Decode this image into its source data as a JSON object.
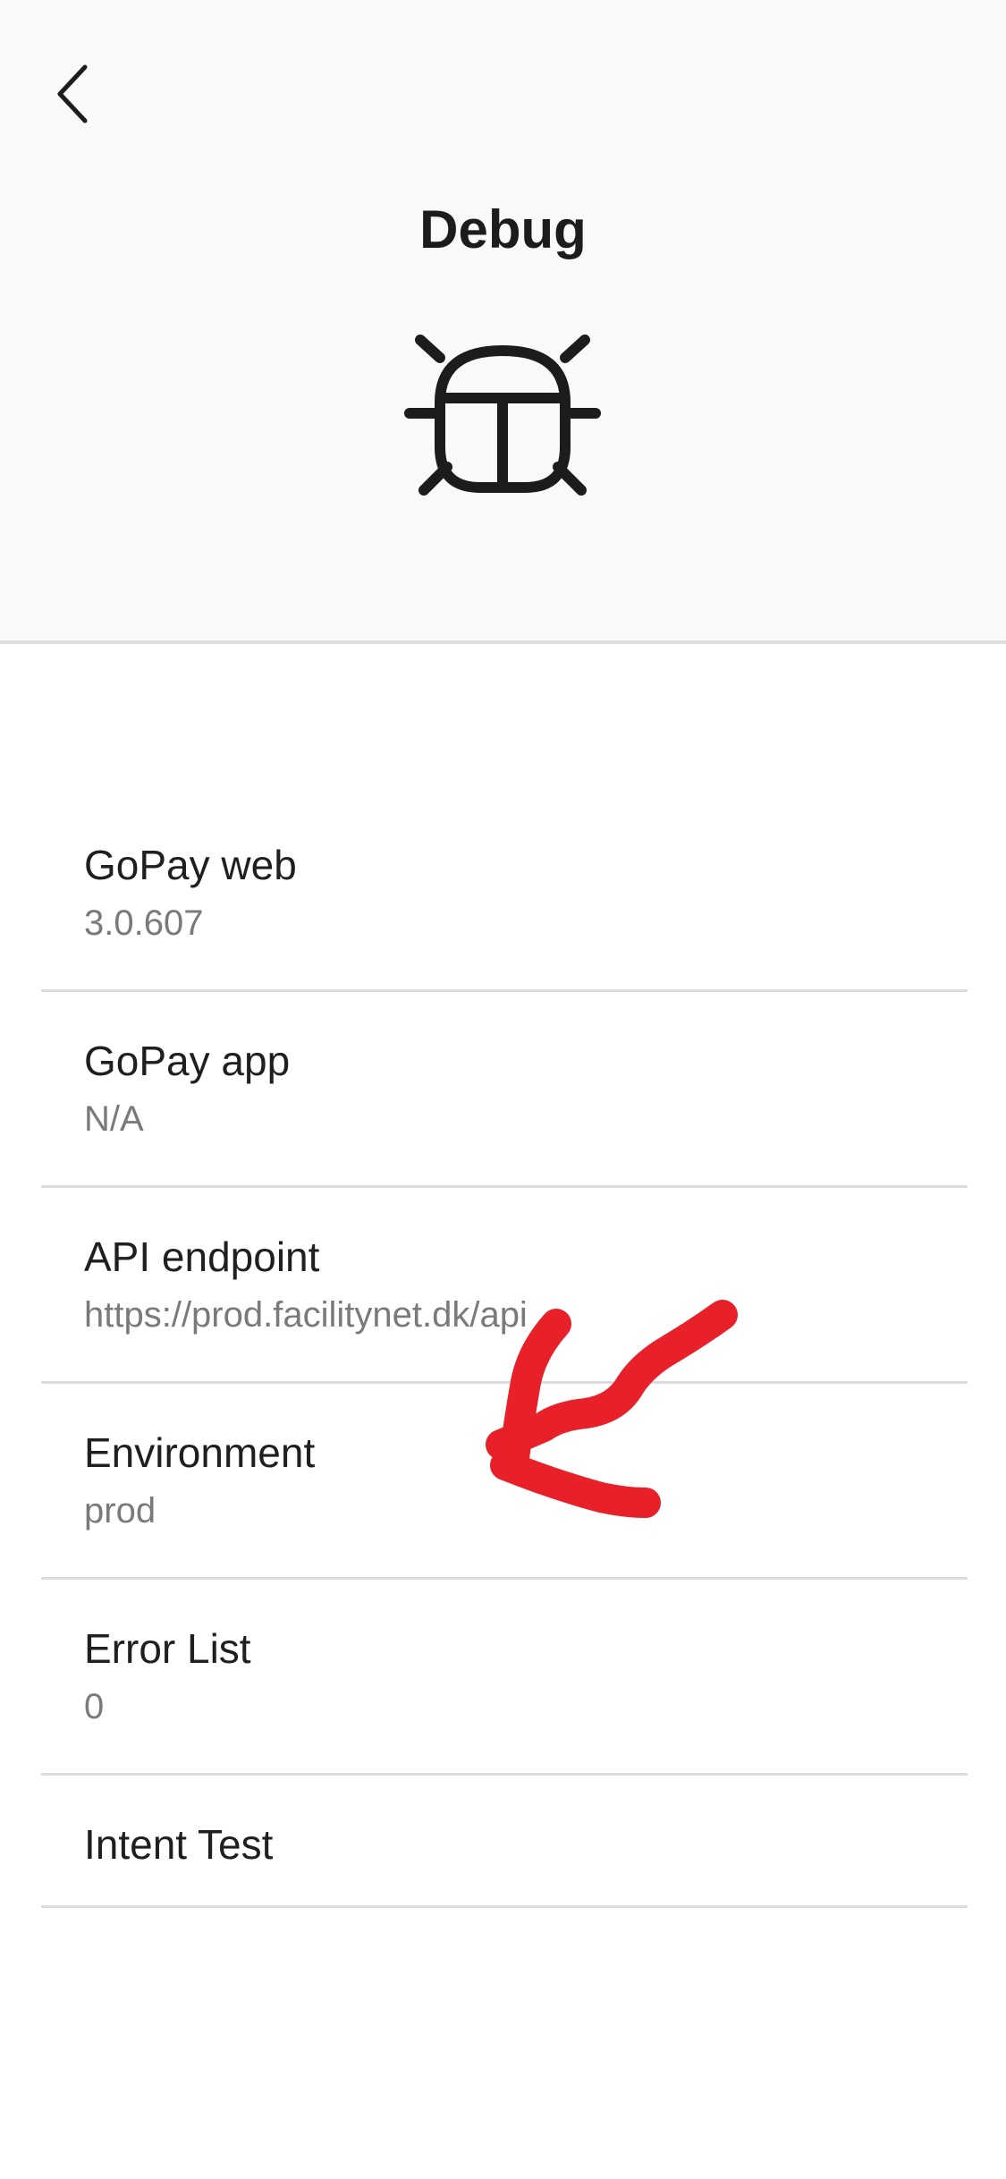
{
  "header": {
    "title": "Debug",
    "back_icon": "chevron-left-icon",
    "bug_icon": "bug-icon"
  },
  "list": {
    "items": [
      {
        "title": "GoPay web",
        "value": "3.0.607"
      },
      {
        "title": "GoPay app",
        "value": "N/A"
      },
      {
        "title": "API endpoint",
        "value": "https://prod.facilitynet.dk/api"
      },
      {
        "title": "Environment",
        "value": "prod"
      },
      {
        "title": "Error List",
        "value": "0"
      },
      {
        "title": "Intent Test"
      }
    ]
  },
  "colors": {
    "header_background": "#f9f9fc",
    "divider": "#dcdcdf",
    "secondary_text": "#7a7a7a",
    "annotation_red": "#e8202a"
  }
}
